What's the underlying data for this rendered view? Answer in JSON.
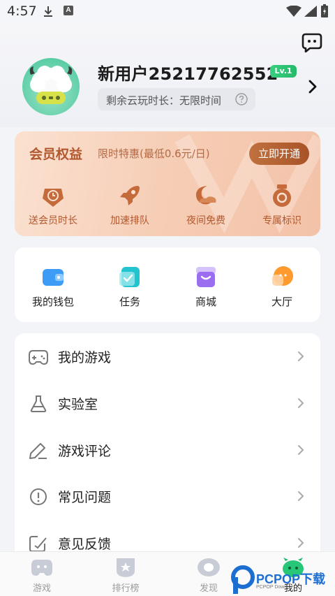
{
  "status_bar": {
    "time": "4:57",
    "a_icon_letter": "A"
  },
  "profile": {
    "username": "新用户25217762552",
    "level": "Lv.1",
    "remaining_time": "剩余云玩时长：无限时间"
  },
  "vip": {
    "title": "会员权益",
    "promo": "限时特惠(最低0.6元/日)",
    "cta": "立即开通",
    "benefits": [
      {
        "label": "送会员时长",
        "icon": "clock-icon"
      },
      {
        "label": "加速排队",
        "icon": "rocket-icon"
      },
      {
        "label": "夜间免费",
        "icon": "moon-icon"
      },
      {
        "label": "专属标识",
        "icon": "medal-icon"
      }
    ]
  },
  "quick_actions": [
    {
      "label": "我的钱包",
      "icon": "wallet-icon",
      "color": "#3d9cf5"
    },
    {
      "label": "任务",
      "icon": "task-icon",
      "color": "#22c4cf"
    },
    {
      "label": "商城",
      "icon": "store-icon",
      "color": "#9b6df0"
    },
    {
      "label": "大厅",
      "icon": "chat-icon",
      "color": "#ff9a2e"
    }
  ],
  "menu": [
    {
      "label": "我的游戏",
      "icon": "gamepad-icon"
    },
    {
      "label": "实验室",
      "icon": "flask-icon"
    },
    {
      "label": "游戏评论",
      "icon": "pen-icon"
    },
    {
      "label": "常见问题",
      "icon": "info-icon"
    },
    {
      "label": "意见反馈",
      "icon": "feedback-icon"
    }
  ],
  "bottom_nav": [
    {
      "label": "游戏",
      "icon": "game-tab-icon",
      "active": false
    },
    {
      "label": "排行榜",
      "icon": "ranking-tab-icon",
      "active": false
    },
    {
      "label": "发现",
      "icon": "discover-tab-icon",
      "active": false
    },
    {
      "label": "我的",
      "icon": "profile-tab-icon",
      "active": true
    }
  ],
  "watermark": {
    "brand": "PCPOP下载",
    "sub": "PCPOP Down"
  },
  "colors": {
    "accent_green": "#27b96a",
    "vip_brown": "#b2582e",
    "background": "#f3f4f8"
  }
}
